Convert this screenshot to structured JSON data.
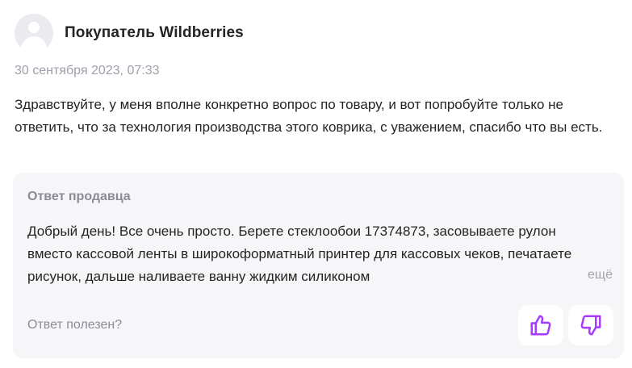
{
  "review": {
    "author": "Покупатель Wildberries",
    "date": "30 сентября 2023, 07:33",
    "question_text": "Здравствуйте, у меня вполне конкретно вопрос по товару, и вот попробуйте только не ответить, что за технология производства этого коврика, с уважением, спасибо что вы есть."
  },
  "answer": {
    "title": "Ответ продавца",
    "text": "Добрый день! Все очень просто. Берете стеклообои 17374873, засовываете рулон вместо кассовой ленты в широкоформатный принтер для кассовых чеков, печатаете рисунок, дальше наливаете ванну жидким силиконом",
    "more_label": "ещё",
    "helpful_label": "Ответ полезен?"
  },
  "icons": {
    "avatar": "user-avatar-icon",
    "like": "thumbs-up-icon",
    "dislike": "thumbs-down-icon"
  },
  "colors": {
    "accent": "#a73afd",
    "panel": "#f6f6f9",
    "muted": "#9e9eaa"
  }
}
